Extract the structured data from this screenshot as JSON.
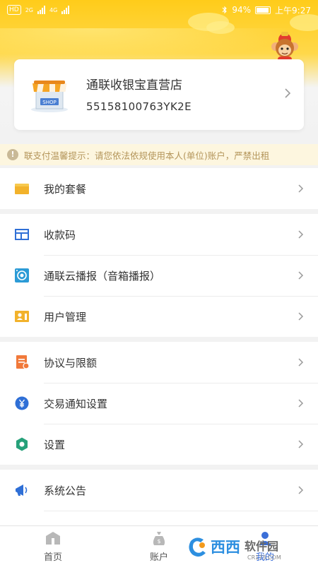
{
  "status_bar": {
    "hd_badge": "HD",
    "network_labels": [
      "2G",
      "4G"
    ],
    "battery": "94%",
    "time": "上午9:27"
  },
  "store": {
    "name": "通联收银宝直营店",
    "id": "55158100763YK2E",
    "shop_sign": "SHOP"
  },
  "notice": {
    "icon": "!",
    "text": "联支付温馨提示：请您依法依规使用本人(单位)账户，严禁出租"
  },
  "menu": {
    "my_package": "我的套餐",
    "payment_code": "收款码",
    "cloud_broadcast": "通联云播报（音箱播报）",
    "user_management": "用户管理",
    "agreement_limits": "协议与限额",
    "transaction_notify": "交易通知设置",
    "settings": "设置",
    "system_announcement": "系统公告"
  },
  "nav": {
    "home": "首页",
    "account": "账户",
    "mine": "我的"
  },
  "watermark": {
    "brand": "西西",
    "software": "软件园",
    "domain": "CR173.COM"
  },
  "colors": {
    "header_yellow": "#ffcc1a",
    "notice_bg": "#fdf6df",
    "accent_blue": "#3b6fd8",
    "orange": "#f1793a",
    "green": "#26a17a"
  }
}
